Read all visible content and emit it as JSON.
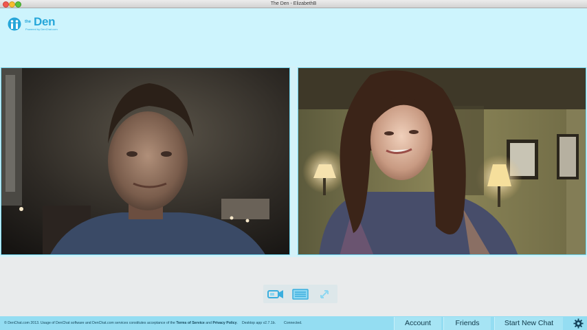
{
  "window": {
    "title": "The Den - ElizabethB"
  },
  "logo": {
    "small": "the",
    "big": "Den",
    "tagline": "Powered by DenChat.com",
    "color": "#26a6d9"
  },
  "colors": {
    "header_bg": "#cdf4fd",
    "footer_bg": "#94ddf2",
    "accent": "#26a6d9"
  },
  "videos": [
    {
      "name": "remote-video-left",
      "icon": "video-feed"
    },
    {
      "name": "remote-video-right",
      "icon": "video-feed"
    }
  ],
  "controls": [
    {
      "name": "camera-icon"
    },
    {
      "name": "chat-icon"
    },
    {
      "name": "resize-icon"
    }
  ],
  "footer": {
    "copyright_prefix": "© DenChat.com 2013. Usage of DenChat software and DenChat.com services constitutes acceptance of the ",
    "tos": "Terms of Service",
    "and": " and ",
    "privacy": "Privacy Policy",
    "period": ".",
    "version": "Desktop app v2.7.1b.",
    "status": "Connected.",
    "buttons": {
      "account": "Account",
      "friends": "Friends",
      "start_new_chat": "Start New Chat"
    },
    "gear_icon": "gear-icon"
  }
}
